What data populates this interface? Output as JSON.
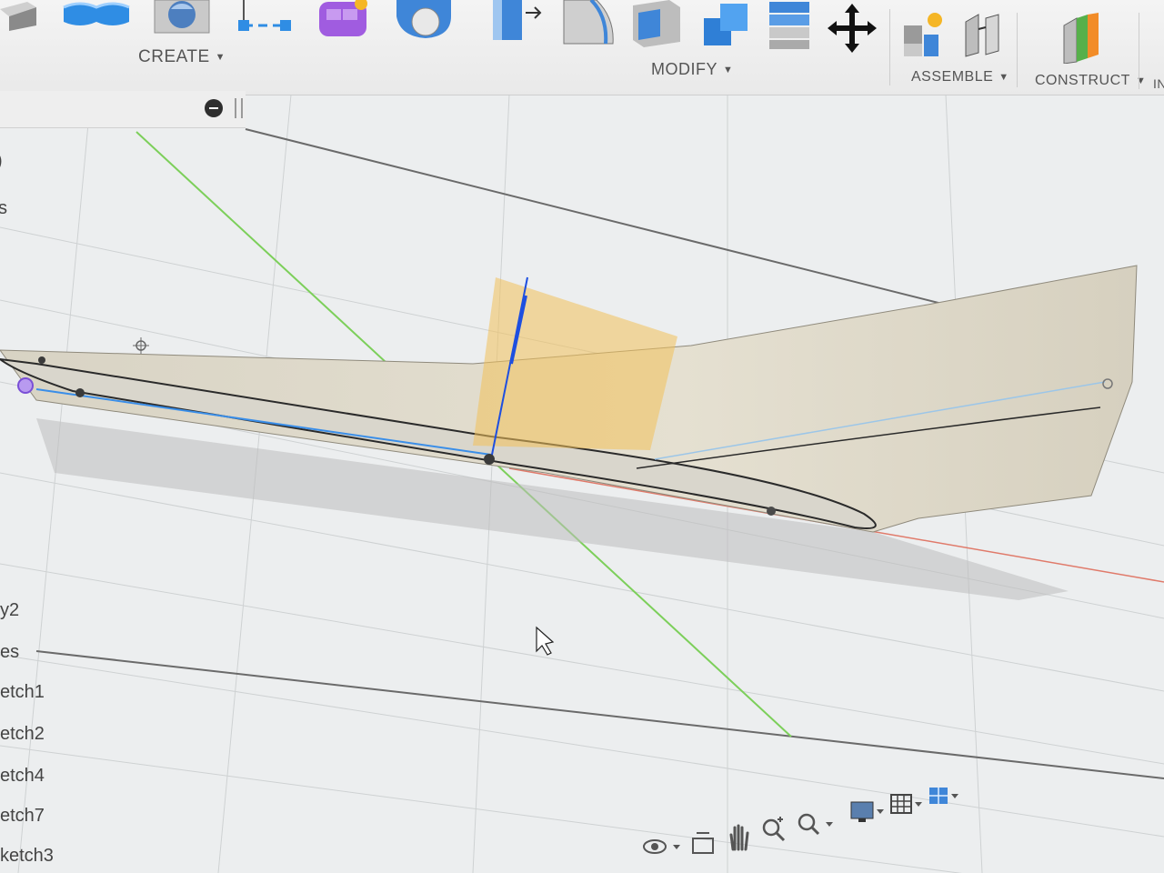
{
  "toolbar": {
    "create_label": "CREATE",
    "modify_label": "MODIFY",
    "assemble_label": "ASSEMBLE",
    "construct_label": "CONSTRUCT",
    "inspect_label_partial": "IN",
    "icons": {
      "create": [
        "extrude-icon",
        "revolve-icon",
        "hole-icon",
        "sketch-line-icon",
        "form-icon",
        "pipe-icon"
      ],
      "modify": [
        "press-pull-icon",
        "fillet-icon",
        "shell-icon",
        "combine-icon",
        "stack-icon",
        "move-icon"
      ],
      "assemble": [
        "new-component-icon",
        "joint-icon"
      ],
      "construct": [
        "plane-icon"
      ]
    }
  },
  "browser": {
    "items": [
      "y2",
      "es",
      "etch1",
      "etch2",
      "etch4",
      "etch7",
      "ketch3"
    ],
    "partial_top_chars": [
      ")",
      "s"
    ]
  },
  "navbar": {
    "icons": [
      "orbit-icon",
      "look-at-icon",
      "pan-icon",
      "zoom-icon",
      "fit-icon",
      "display-settings-icon",
      "grid-settings-icon",
      "viewports-icon"
    ]
  },
  "colors": {
    "toolbar_bg": "#eeeeee",
    "canvas_bg": "#eceeef",
    "body_fill": "#e6e1d2",
    "sketch_plane": "#f2c15a",
    "axis_blue": "#1e4fe0",
    "axis_green": "#7ccf5a",
    "axis_red": "#e07a6a",
    "icon_blue": "#2f8de4",
    "icon_purple": "#a05ce0"
  }
}
